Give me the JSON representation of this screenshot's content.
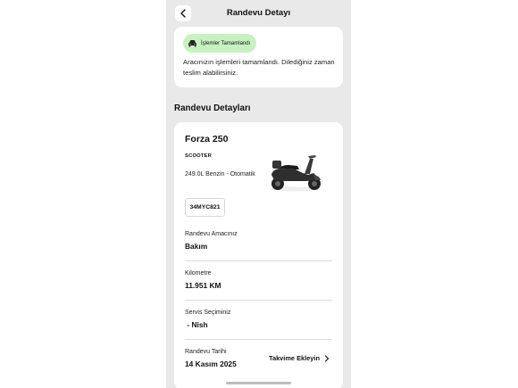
{
  "header": {
    "title": "Randevu Detayı"
  },
  "status": {
    "badge_label": "İşlemler Tamamlandı",
    "message": "Aracınızın işlemleri tamamlandı. Dilediğiniz zaman teslim alabilirsiniz."
  },
  "section": {
    "title": "Randevu Detayları"
  },
  "vehicle": {
    "model": "Forza 250",
    "type": "SCOOTER",
    "spec": "249.0L Benzin - Otomatik",
    "plate": "34MYC821"
  },
  "fields": {
    "purpose": {
      "label": "Randevu Amacınız",
      "value": "Bakım"
    },
    "mileage": {
      "label": "Kilometre",
      "value": "11.951 KM"
    },
    "service": {
      "label": "Servis Seçiminiz",
      "value": " - Nish"
    },
    "date": {
      "label": "Randevu Tarihi",
      "value": "14 Kasım 2025"
    }
  },
  "calendar": {
    "label": "Takvime Ekleyin"
  },
  "colors": {
    "badge_bg": "#c6f2bf",
    "screen_bg": "#e9e9e9",
    "card_bg": "#ffffff"
  }
}
